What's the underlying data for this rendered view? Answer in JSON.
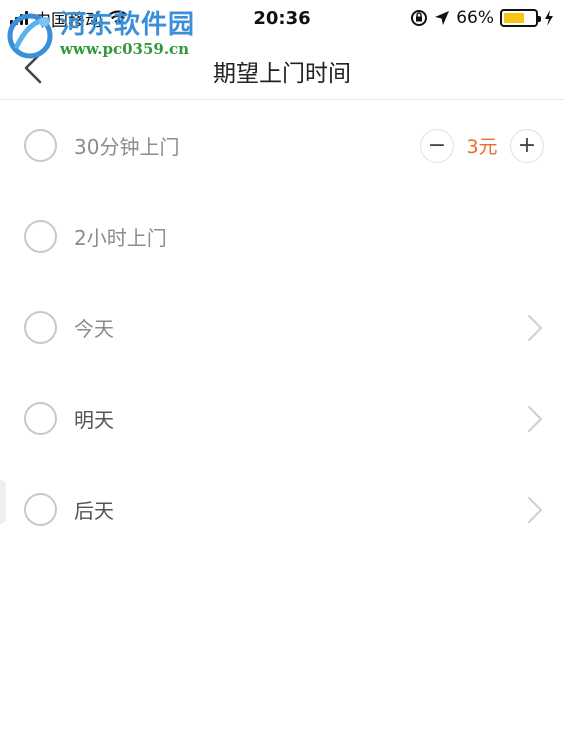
{
  "status_bar": {
    "carrier": "中国移动",
    "time": "20:36",
    "battery_percent": "66%",
    "battery_level": 0.66
  },
  "watermark": {
    "title": "河东软件园",
    "url": "www.pc0359.cn"
  },
  "nav": {
    "title": "期望上门时间",
    "back_icon": "chevron-left-icon"
  },
  "options": [
    {
      "label": "30分钟上门",
      "has_stepper": true
    },
    {
      "label": "2小时上门"
    },
    {
      "label": "今天",
      "has_chevron": true
    },
    {
      "label": "明天",
      "has_chevron": true
    },
    {
      "label": "后天",
      "has_chevron": true
    }
  ],
  "stepper": {
    "minus": "−",
    "value": "3元",
    "plus": "+"
  },
  "colors": {
    "accent": "#f06a2c",
    "battery": "#f5c518",
    "watermark_blue": "#3a8fd8",
    "watermark_green": "#2f9a3a"
  }
}
